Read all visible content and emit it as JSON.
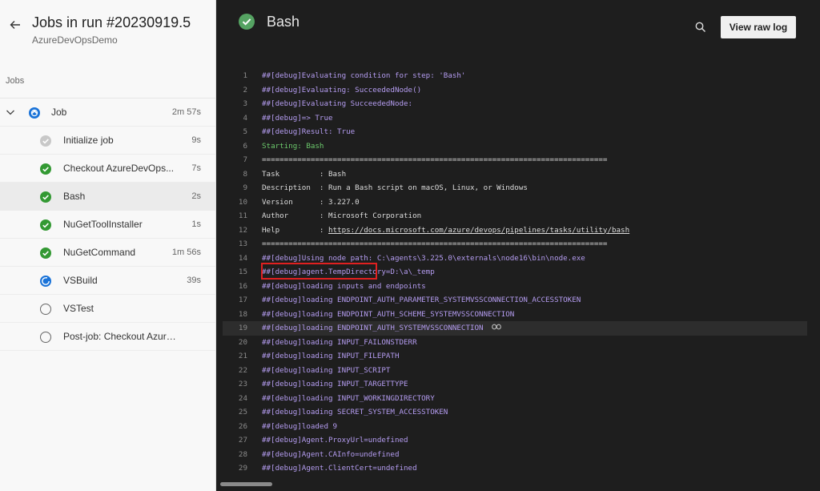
{
  "run": {
    "title": "Jobs in run #20230919.5",
    "project": "AzureDevOpsDemo",
    "jobs_label": "Jobs"
  },
  "job": {
    "name": "Job",
    "duration": "2m 57s",
    "status": "running"
  },
  "steps": [
    {
      "name": "Initialize job",
      "duration": "9s",
      "status": "skipped"
    },
    {
      "name": "Checkout AzureDevOps...",
      "duration": "7s",
      "status": "succeeded"
    },
    {
      "name": "Bash",
      "duration": "2s",
      "status": "succeeded",
      "selected": true
    },
    {
      "name": "NuGetToolInstaller",
      "duration": "1s",
      "status": "succeeded"
    },
    {
      "name": "NuGetCommand",
      "duration": "1m 56s",
      "status": "succeeded"
    },
    {
      "name": "VSBuild",
      "duration": "39s",
      "status": "running"
    },
    {
      "name": "VSTest",
      "duration": "",
      "status": "pending"
    },
    {
      "name": "Post-job: Checkout Azure...",
      "duration": "",
      "status": "pending"
    }
  ],
  "log_header": {
    "title": "Bash",
    "view_raw_label": "View raw log",
    "search_icon": "search-icon"
  },
  "log": {
    "line_numbers": [
      "1",
      "2",
      "3",
      "4",
      "5",
      "6",
      "7",
      "8",
      "9",
      "10",
      "11",
      "12",
      "13",
      "14",
      "15",
      "16",
      "17",
      "18",
      "19",
      "20",
      "21",
      "22",
      "23",
      "24",
      "25",
      "26",
      "27",
      "28",
      "29"
    ],
    "lines": [
      "##[debug]Evaluating condition for step: 'Bash'",
      "##[debug]Evaluating: SucceededNode()",
      "##[debug]Evaluating SucceededNode:",
      "##[debug]=> True",
      "##[debug]Result: True",
      "Starting: Bash",
      "==============================================================================",
      "Task         : Bash",
      "Description  : Run a Bash script on macOS, Linux, or Windows",
      "Version      : 3.227.0",
      "Author       : Microsoft Corporation",
      "Help         : ",
      "==============================================================================",
      "##[debug]Using node path: C:\\agents\\3.225.0\\externals\\node16\\bin\\node.exe",
      "##[debug]agent.TempDirectory=D:\\a\\_temp",
      "##[debug]loading inputs and endpoints",
      "##[debug]loading ENDPOINT_AUTH_PARAMETER_SYSTEMVSSCONNECTION_ACCESSTOKEN",
      "##[debug]loading ENDPOINT_AUTH_SCHEME_SYSTEMVSSCONNECTION",
      "##[debug]loading ENDPOINT_AUTH_SYSTEMVSSCONNECTION",
      "##[debug]loading INPUT_FAILONSTDERR",
      "##[debug]loading INPUT_FILEPATH",
      "##[debug]loading INPUT_SCRIPT",
      "##[debug]loading INPUT_TARGETTYPE",
      "##[debug]loading INPUT_WORKINGDIRECTORY",
      "##[debug]loading SECRET_SYSTEM_ACCESSTOKEN",
      "##[debug]loaded 9",
      "##[debug]Agent.ProxyUrl=undefined",
      "##[debug]Agent.CAInfo=undefined",
      "##[debug]Agent.ClientCert=undefined"
    ],
    "help_link": "https://docs.microsoft.com/azure/devops/pipelines/tasks/utility/bash",
    "link_icon": "link-icon",
    "highlighted_line": "19",
    "boxed_line": "10"
  },
  "colors": {
    "success": "#339933",
    "running": "#1a73d8",
    "debug_text": "#b49cf0",
    "section_text": "#6cc96c",
    "annotation_box": "#e02020"
  }
}
